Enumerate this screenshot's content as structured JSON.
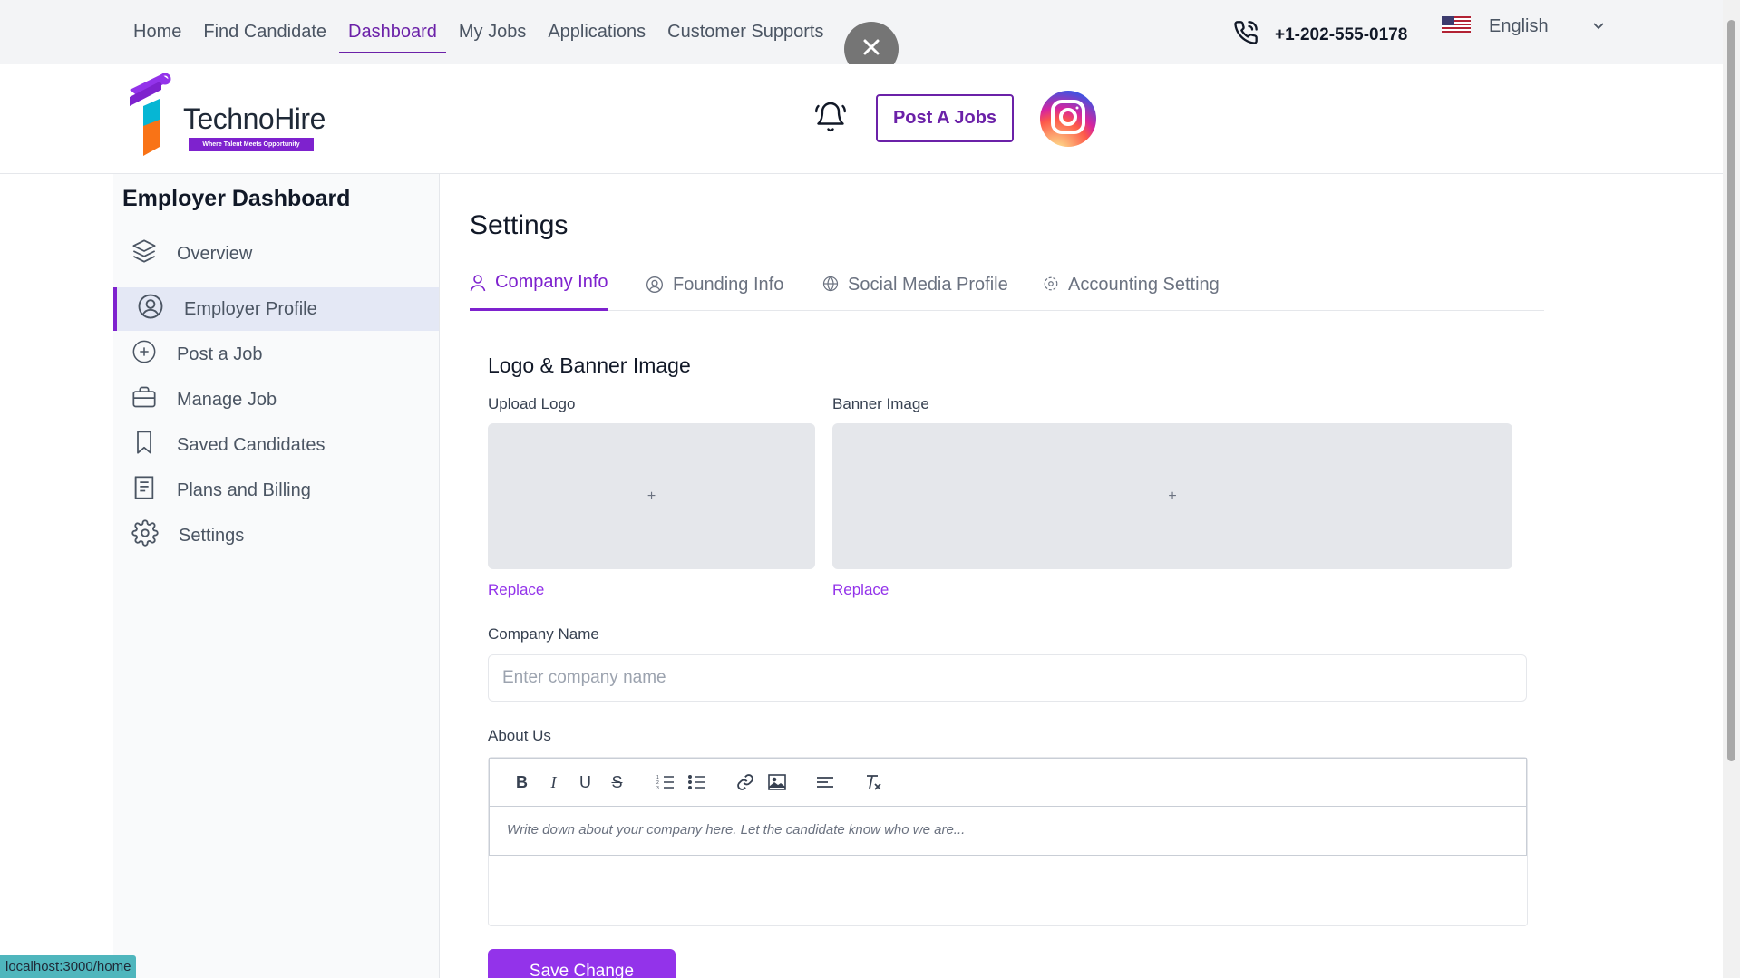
{
  "topnav": {
    "items": [
      "Home",
      "Find Candidate",
      "Dashboard",
      "My Jobs",
      "Applications",
      "Customer Supports"
    ],
    "active": "Dashboard",
    "phone": "+1-202-555-0178",
    "language": "English"
  },
  "header": {
    "logo_text": "TechnoHire",
    "logo_tagline": "Where Talent Meets Opportunity",
    "post_button": "Post A Jobs"
  },
  "sidebar": {
    "title": "Employer Dashboard",
    "items": [
      {
        "label": "Overview",
        "icon": "layers-icon"
      },
      {
        "label": "Employer Profile",
        "icon": "user-circle-icon"
      },
      {
        "label": "Post a Job",
        "icon": "plus-circle-icon"
      },
      {
        "label": "Manage Job",
        "icon": "briefcase-icon"
      },
      {
        "label": "Saved Candidates",
        "icon": "bookmark-icon"
      },
      {
        "label": "Plans and Billing",
        "icon": "billing-icon"
      },
      {
        "label": "Settings",
        "icon": "gear-icon"
      }
    ],
    "active": "Employer Profile"
  },
  "main": {
    "title": "Settings",
    "tabs": [
      {
        "label": "Company Info",
        "icon": "user-icon"
      },
      {
        "label": "Founding Info",
        "icon": "user-circle-icon"
      },
      {
        "label": "Social Media Profile",
        "icon": "globe-icon"
      },
      {
        "label": "Accounting Setting",
        "icon": "gear-icon"
      }
    ],
    "active_tab": "Company Info",
    "section_title": "Logo & Banner Image",
    "upload_logo_label": "Upload Logo",
    "banner_label": "Banner Image",
    "upload_plus": "+",
    "replace_label": "Replace",
    "company_name_label": "Company Name",
    "company_name_placeholder": "Enter company name",
    "company_name_value": "",
    "about_label": "About Us",
    "about_placeholder": "Write down about your company here. Let the candidate know who we are...",
    "save_button": "Save Change"
  },
  "status_url": "localhost:3000/home",
  "colors": {
    "accent": "#7e22ce",
    "button": "#9333ea",
    "topbar": "#f3f4f6",
    "sidebar_active": "#e4e8f5"
  }
}
